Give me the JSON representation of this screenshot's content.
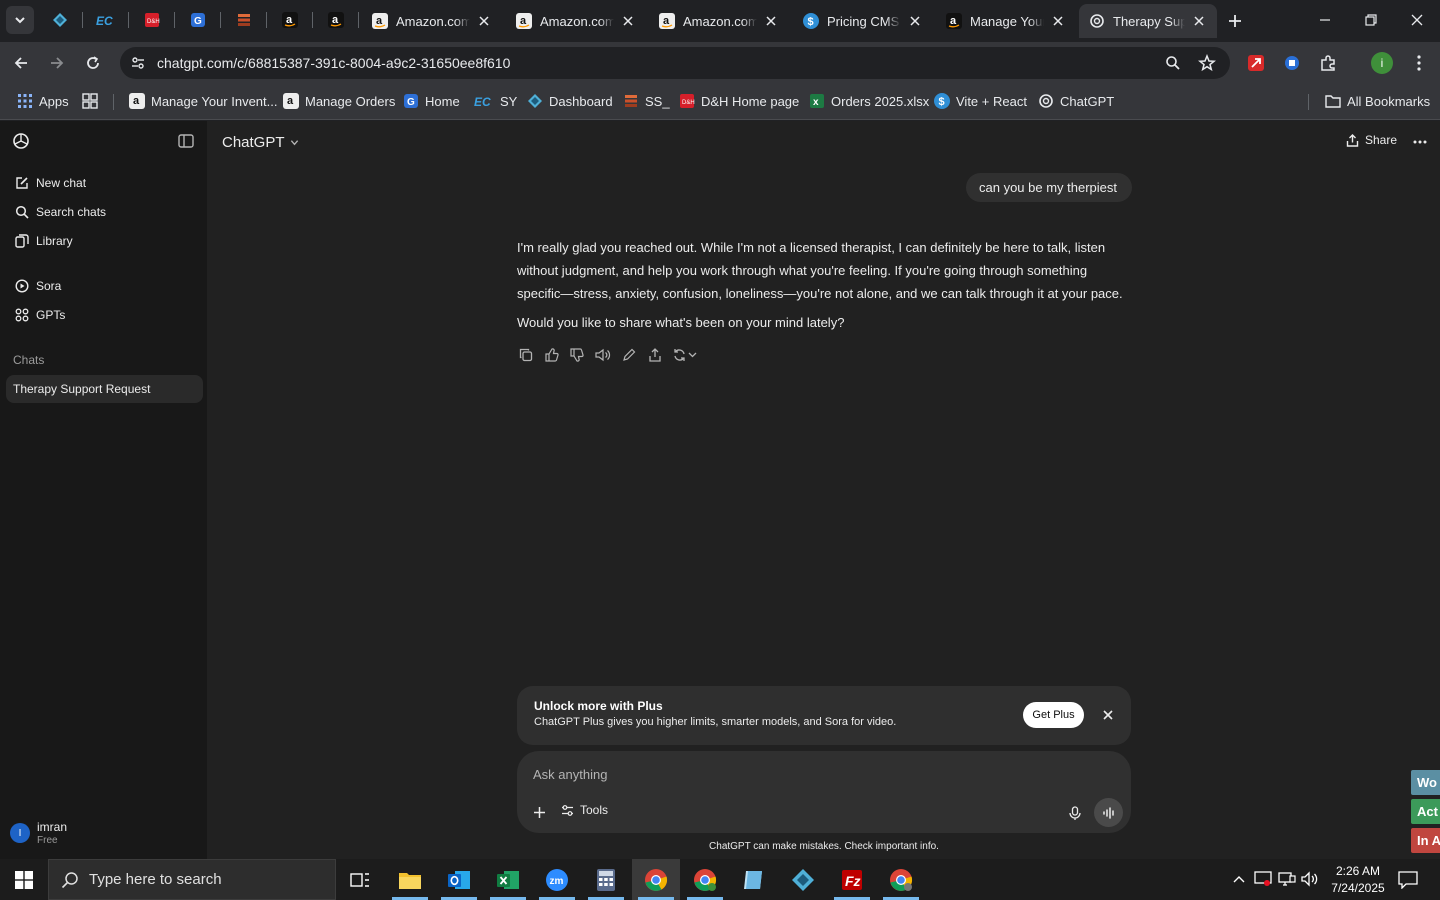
{
  "browser": {
    "tabs": [
      {
        "title": "Amazon.com:",
        "favicon": "amazon-icon"
      },
      {
        "title": "Amazon.com:",
        "favicon": "amazon-icon"
      },
      {
        "title": "Amazon.com:",
        "favicon": "amazon-icon"
      },
      {
        "title": "Pricing CMS",
        "favicon": "dollar-icon"
      },
      {
        "title": "Manage Your",
        "favicon": "amazon-icon"
      },
      {
        "title": "Therapy Supp",
        "favicon": "openai-icon",
        "active": true
      }
    ],
    "pinned_tabs": [
      "diamond-icon",
      "ec-icon",
      "dh-icon",
      "g-icon",
      "stack-icon",
      "amazon-icon",
      "amazon-icon"
    ],
    "url": "chatgpt.com/c/68815387-391c-8004-a9c2-31650ee8f610",
    "bookmarks": [
      {
        "label": "Apps",
        "icon": "apps-grid-icon"
      },
      {
        "label": "Manage Your Invent...",
        "icon": "amazon-icon"
      },
      {
        "label": "Manage Orders",
        "icon": "amazon-icon"
      },
      {
        "label": "Home",
        "icon": "g-icon"
      },
      {
        "label": "SY",
        "icon": "ec-icon"
      },
      {
        "label": "Dashboard",
        "icon": "diamond-icon"
      },
      {
        "label": "SS_",
        "icon": "stack-icon"
      },
      {
        "label": "D&H Home page",
        "icon": "dh-icon"
      },
      {
        "label": "Orders 2025.xlsx",
        "icon": "excel-icon"
      },
      {
        "label": "Vite + React",
        "icon": "dollar-icon"
      },
      {
        "label": "ChatGPT",
        "icon": "openai-icon"
      }
    ],
    "all_bookmarks": "All Bookmarks",
    "profile_initial": "i"
  },
  "sidebar": {
    "nav": [
      {
        "label": "New chat",
        "icon": "edit-icon"
      },
      {
        "label": "Search chats",
        "icon": "search-icon"
      },
      {
        "label": "Library",
        "icon": "library-icon"
      },
      {
        "label": "Sora",
        "icon": "play-icon"
      },
      {
        "label": "GPTs",
        "icon": "gpts-icon"
      }
    ],
    "chats_header": "Chats",
    "chats": [
      "Therapy Support Request"
    ],
    "user": {
      "initial": "I",
      "name": "imran",
      "plan": "Free"
    }
  },
  "header": {
    "model": "ChatGPT",
    "share": "Share"
  },
  "conversation": {
    "user_message": "can you be my therpiest",
    "assistant_paragraphs": [
      "I'm really glad you reached out. While I'm not a licensed therapist, I can definitely be here to talk, listen without judgment, and help you work through what you're feeling. If you're going through something specific—stress, anxiety, confusion, loneliness—you're not alone, and we can talk through it at your pace.",
      "Would you like to share what's been on your mind lately?"
    ]
  },
  "upsell": {
    "title": "Unlock more with Plus",
    "description": "ChatGPT Plus gives you higher limits, smarter models, and Sora for video.",
    "button": "Get Plus"
  },
  "composer": {
    "placeholder": "Ask anything",
    "tools": "Tools"
  },
  "disclaimer": "ChatGPT can make mistakes. Check important info.",
  "side_tabs": [
    {
      "label": "Wo",
      "color": "#5b8fa3"
    },
    {
      "label": "Act",
      "color": "#3c9a5a"
    },
    {
      "label": "In A",
      "color": "#c0463f"
    }
  ],
  "taskbar": {
    "search_placeholder": "Type here to search",
    "time": "2:26 AM",
    "date": "7/24/2025"
  }
}
